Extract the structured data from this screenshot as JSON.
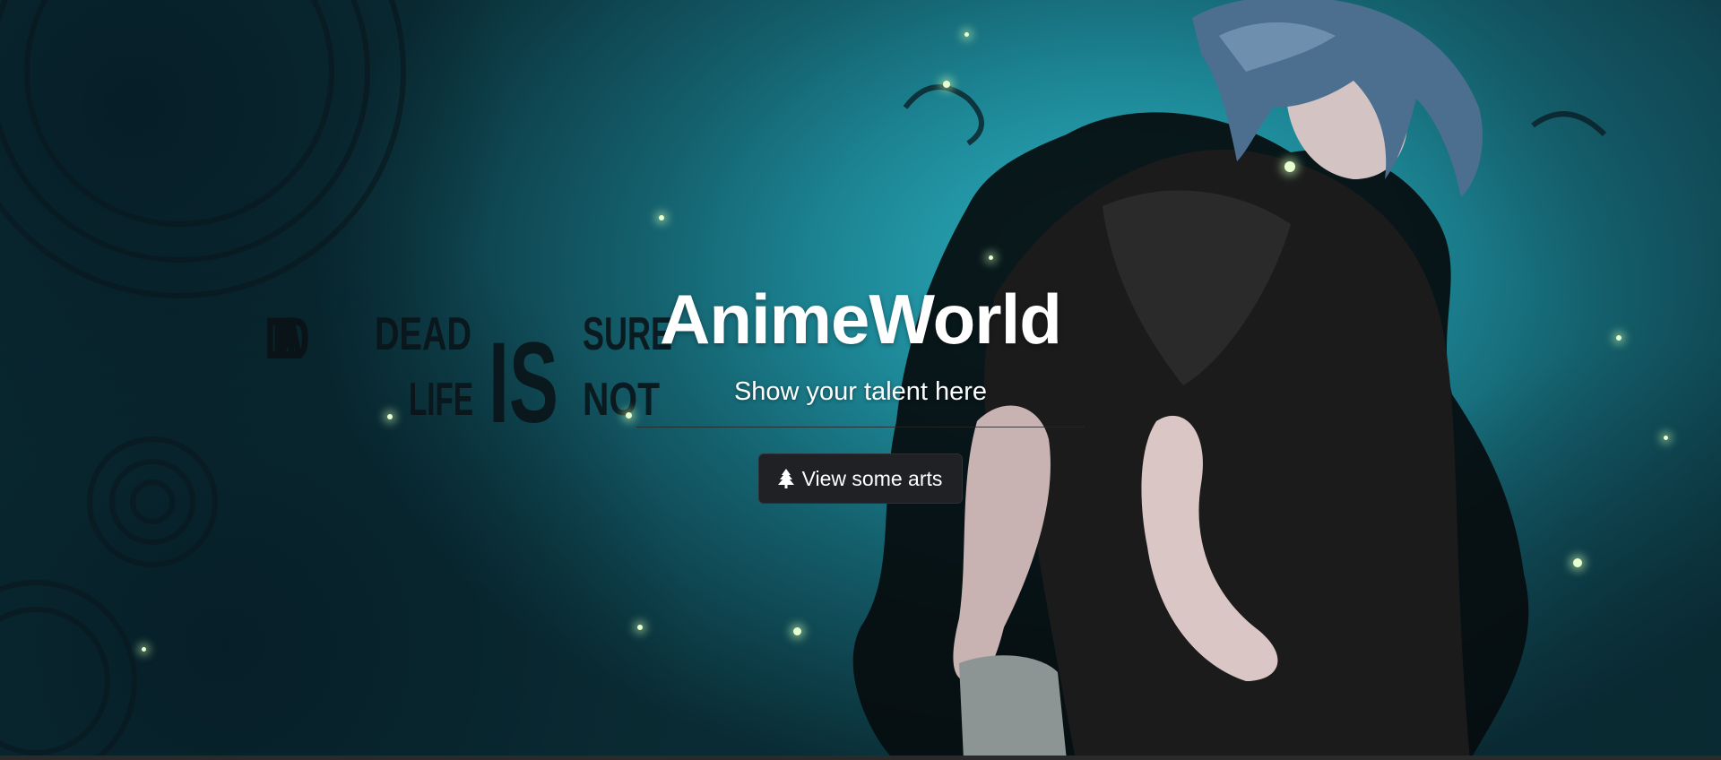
{
  "hero": {
    "title": "AnimeWorld",
    "subtitle": "Show your talent here",
    "cta_label": "View some arts",
    "cta_icon": "tree-icon"
  },
  "background_art_text": {
    "line1_left": "DEAD",
    "line2_left": "LIFE",
    "center": "IS",
    "line1_right": "SURE",
    "line2_right": "NOT"
  },
  "colors": {
    "button_bg": "#1f2125",
    "title_text": "#ffffff",
    "background_accent": "#2fb3c4"
  }
}
